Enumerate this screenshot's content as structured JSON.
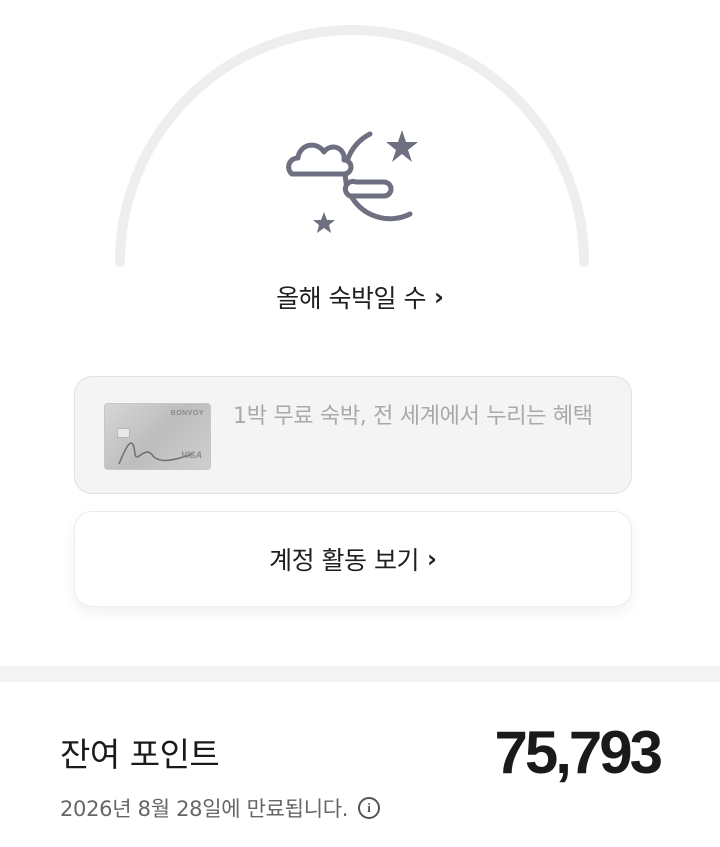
{
  "stay_nights": {
    "label": "올해 숙박일 수",
    "chevron": "›",
    "icon": "moon-cloud-stars-icon"
  },
  "promo_card": {
    "text": "1박 무료 숙박, 전 세계에서 누리는 혜택",
    "card_brand": "BONVOY",
    "card_network": "VISA"
  },
  "activity_button": {
    "label": "계정 활동 보기",
    "chevron": "›"
  },
  "points": {
    "label": "잔여 포인트",
    "value": "75,793",
    "expiry": "2026년 8월 28일에 만료됩니다.",
    "info_icon": "info-icon"
  },
  "colors": {
    "icon_gray": "#6e6f80",
    "arc_gray": "#eeeeee",
    "promo_bg": "#f4f4f4",
    "text_dark": "#1a1a1a"
  }
}
